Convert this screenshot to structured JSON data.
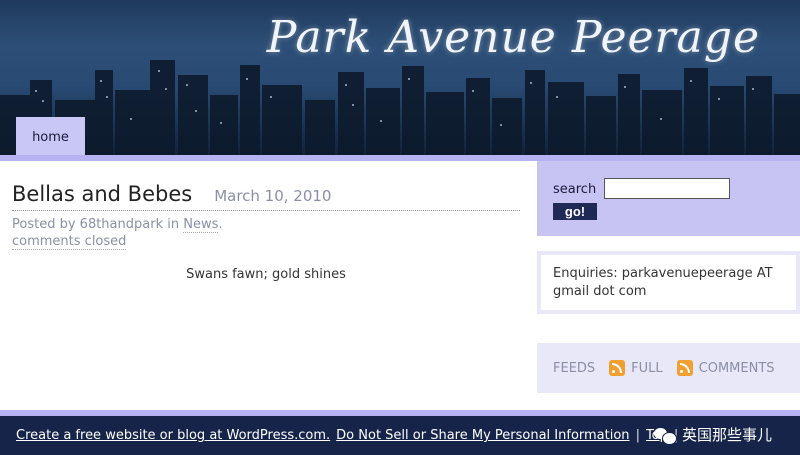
{
  "header": {
    "site_title": "Park Avenue Peerage",
    "nav": [
      {
        "label": "home"
      }
    ]
  },
  "post": {
    "title": "Bellas and Bebes",
    "date": "March 10, 2010",
    "posted_by_prefix": "Posted by",
    "author": "68thandpark",
    "in_word": "in",
    "category": "News",
    "comments": "comments closed",
    "body": "Swans fawn; gold shines"
  },
  "sidebar": {
    "search_label": "search",
    "search_value": "",
    "go_label": "go!",
    "enquiries": "Enquiries: parkavenuepeerage AT gmail dot com",
    "feeds_label": "FEEDS",
    "full_label": "FULL",
    "comments_label": "COMMENTS"
  },
  "footer": {
    "create_link": "Create a free website or blog at WordPress.com.",
    "privacy_link": "Do Not Sell or Share My Personal Information",
    "sep": "|",
    "top_link": "Top",
    "sep2": "|",
    "watermark": "英国那些事儿"
  },
  "colors": {
    "accent": "#c7c4f4",
    "footer_bg": "#16244a",
    "header_bg": "#284a73",
    "feed_icon": "#f0a030"
  },
  "icons": [
    "rss-icon",
    "wechat-icon"
  ]
}
